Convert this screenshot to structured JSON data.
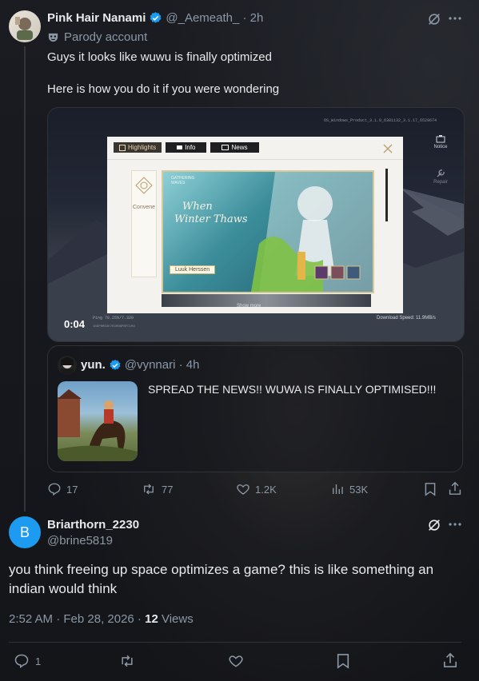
{
  "post": {
    "author_name": "Pink Hair Nanami",
    "handle_time": "@_Aemeath_ · 2h",
    "badge": "Parody account",
    "text_line1": "Guys it looks like wuwu is finally optimized",
    "text_line2": "Here is how you do it if you were wondering",
    "video": {
      "timestamp": "0:04",
      "top_right_text": "OS_Windows_Product_3.1.0_6381132_3.1.17_6529674",
      "left_info": "Ping 78.25%/7.320",
      "left_info2": "1BGPNM34E7E30N6PBFC1M4",
      "download": "Download Speed: 11.9MB/s",
      "notice": "Notice",
      "repair": "Repair",
      "tabs": [
        "Highlights",
        "Info",
        "News"
      ],
      "banner_title_line1": "When",
      "banner_title_line2": "Winter Thaws",
      "banner_small_top": "GATHERING WAVES",
      "character_name": "Luuk Herssen",
      "convene": "Convene",
      "show_more": "Show more"
    },
    "quote": {
      "author_name": "yun.",
      "handle_time": "@vynnari · 4h",
      "text": "SPREAD THE NEWS!! WUWA IS FINALLY OPTIMISED!!!"
    },
    "actions": {
      "replies": "17",
      "reposts": "77",
      "likes": "1.2K",
      "views": "53K"
    }
  },
  "reply": {
    "avatar_letter": "B",
    "author_name": "Briarthorn_2230",
    "handle": "@brine5819",
    "text_line1": "you think freeing up space optimizes a game? this is like something an",
    "text_line2": "indian would think",
    "meta_time": "2:52 AM · Feb 28, 2026 · ",
    "meta_views_count": "12",
    "meta_views_label": " Views",
    "actions": {
      "replies": "1"
    }
  },
  "colors": {
    "accent": "#1d9bf0",
    "muted": "#8b98a5",
    "avatar_b": "#1d9bf0"
  }
}
